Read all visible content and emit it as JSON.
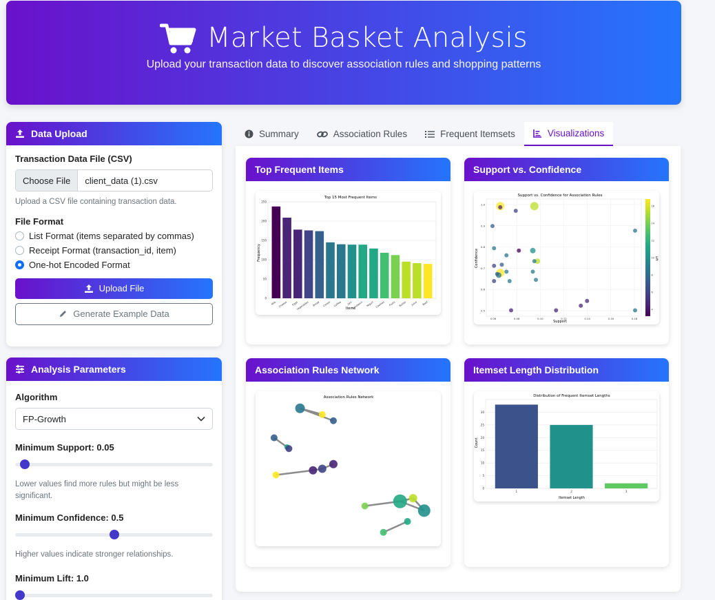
{
  "header": {
    "title": "Market Basket Analysis",
    "subtitle": "Upload your transaction data to discover association rules and shopping patterns",
    "icon": "shopping-cart-icon"
  },
  "data_upload": {
    "heading": "Data Upload",
    "file_label": "Transaction Data File (CSV)",
    "choose_file": "Choose File",
    "file_name": "client_data (1).csv",
    "file_hint": "Upload a CSV file containing transaction data.",
    "format_label": "File Format",
    "formats": [
      {
        "label": "List Format (items separated by commas)",
        "selected": false
      },
      {
        "label": "Receipt Format (transaction_id, item)",
        "selected": false
      },
      {
        "label": "One-hot Encoded Format",
        "selected": true
      }
    ],
    "upload_button": "Upload File",
    "example_button": "Generate Example Data"
  },
  "analysis": {
    "heading": "Analysis Parameters",
    "algorithm_label": "Algorithm",
    "algorithm_value": "FP-Growth",
    "min_support_label": "Minimum Support: 0.05",
    "min_support_level": 0.05,
    "support_hint": "Lower values find more rules but might be less significant.",
    "min_confidence_label": "Minimum Confidence: 0.5",
    "min_confidence_level": 0.5,
    "confidence_hint": "Higher values indicate stronger relationships.",
    "min_lift_label": "Minimum Lift: 1.0",
    "min_lift_level": 0.0
  },
  "tabs": [
    {
      "label": "Summary",
      "icon": "info-icon",
      "active": false
    },
    {
      "label": "Association Rules",
      "icon": "link-icon",
      "active": false
    },
    {
      "label": "Frequent Itemsets",
      "icon": "list-icon",
      "active": false
    },
    {
      "label": "Visualizations",
      "icon": "chart-icon",
      "active": true
    }
  ],
  "viz_titles": {
    "top_items": "Top Frequent Items",
    "support_conf": "Support vs. Confidence",
    "network": "Association Rules Network",
    "length_dist": "Itemset Length Distribution"
  },
  "chart_data": [
    {
      "type": "bar",
      "title": "Top 15 Most Frequent Items",
      "xlabel": "Items",
      "ylabel": "Frequency",
      "ylim": [
        0,
        250
      ],
      "yticks": [
        "0",
        "50",
        "100",
        "150",
        "200",
        "250"
      ],
      "categories": [
        "Milk",
        "Cheese",
        "Eggs",
        "Vegetables",
        "Bread",
        "Cereal",
        "Coffee",
        "Jam",
        "Sandwich",
        "Yogurt",
        "Cookies",
        "Fruits",
        "Butter",
        "Juice",
        "Beef"
      ],
      "values": [
        238,
        209,
        178,
        176,
        174,
        145,
        140,
        139,
        139,
        129,
        118,
        112,
        95,
        91,
        89
      ]
    },
    {
      "type": "scatter",
      "title": "Support vs. Confidence for Association Rules",
      "xlabel": "Support",
      "ylabel": "Confidence",
      "colorbar_label": "Lift",
      "xticks": [
        "0.06",
        "0.08",
        "0.10",
        "0.12",
        "0.14",
        "0.16",
        "0.18"
      ],
      "yticks": [
        "0.5",
        "0.6",
        "0.7",
        "0.8",
        "0.9",
        "1.0"
      ],
      "colorbar_ticks": [
        "4",
        "6",
        "8",
        "10",
        "12",
        "14",
        "16"
      ]
    },
    {
      "type": "network",
      "title": "Association Rules Network"
    },
    {
      "type": "bar",
      "title": "Distribution of Frequent Itemset Lengths",
      "xlabel": "Itemset Length",
      "ylabel": "Count",
      "ylim": [
        0,
        35
      ],
      "yticks": [
        "0",
        "5",
        "10",
        "15",
        "20",
        "25",
        "30"
      ],
      "categories": [
        "1",
        "2",
        "3"
      ],
      "values": [
        33,
        25,
        2
      ],
      "colors": [
        "#3b528b",
        "#21918c",
        "#5ec962"
      ]
    }
  ]
}
